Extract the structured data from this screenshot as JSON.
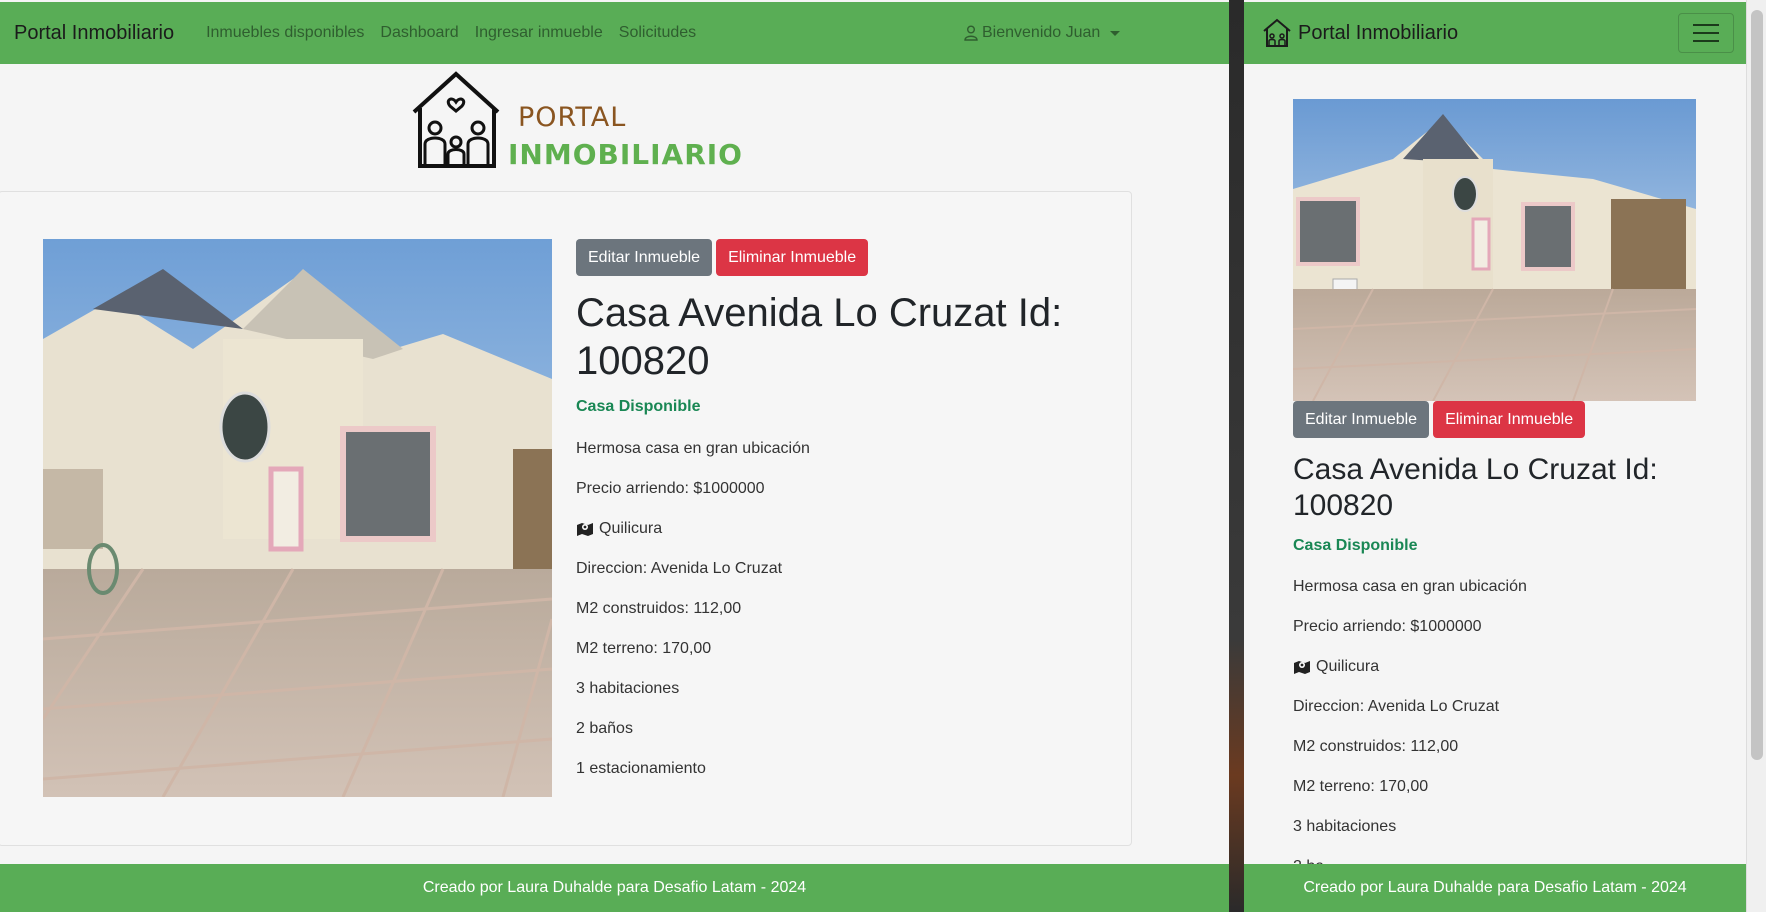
{
  "nav": {
    "brand": "Portal Inmobiliario",
    "links": [
      "Inmuebles disponibles",
      "Dashboard",
      "Ingresar inmueble",
      "Solicitudes"
    ],
    "user": "Bienvenido Juan"
  },
  "logo": {
    "line1": "PORTAL",
    "line2": "INMOBILIARIO"
  },
  "property": {
    "edit_label": "Editar Inmueble",
    "delete_label": "Eliminar Inmueble",
    "title": "Casa Avenida Lo Cruzat Id: 100820",
    "status": "Casa Disponible",
    "description": "Hermosa casa en gran ubicación",
    "price": "Precio arriendo: $1000000",
    "commune": "Quilicura",
    "address": "Direccion: Avenida Lo Cruzat",
    "m2_built": "M2 construidos: 112,00",
    "m2_land": "M2 terreno: 170,00",
    "rooms": "3 habitaciones",
    "baths": "2 baños",
    "parking": "1 estacionamiento",
    "baths_partial": "2 ba"
  },
  "footer": "Creado por Laura Duhalde para Desafio Latam - 2024",
  "colors": {
    "nav": "#59ad56",
    "danger": "#dc3545",
    "secondary": "#6c757d",
    "success": "#198754"
  }
}
